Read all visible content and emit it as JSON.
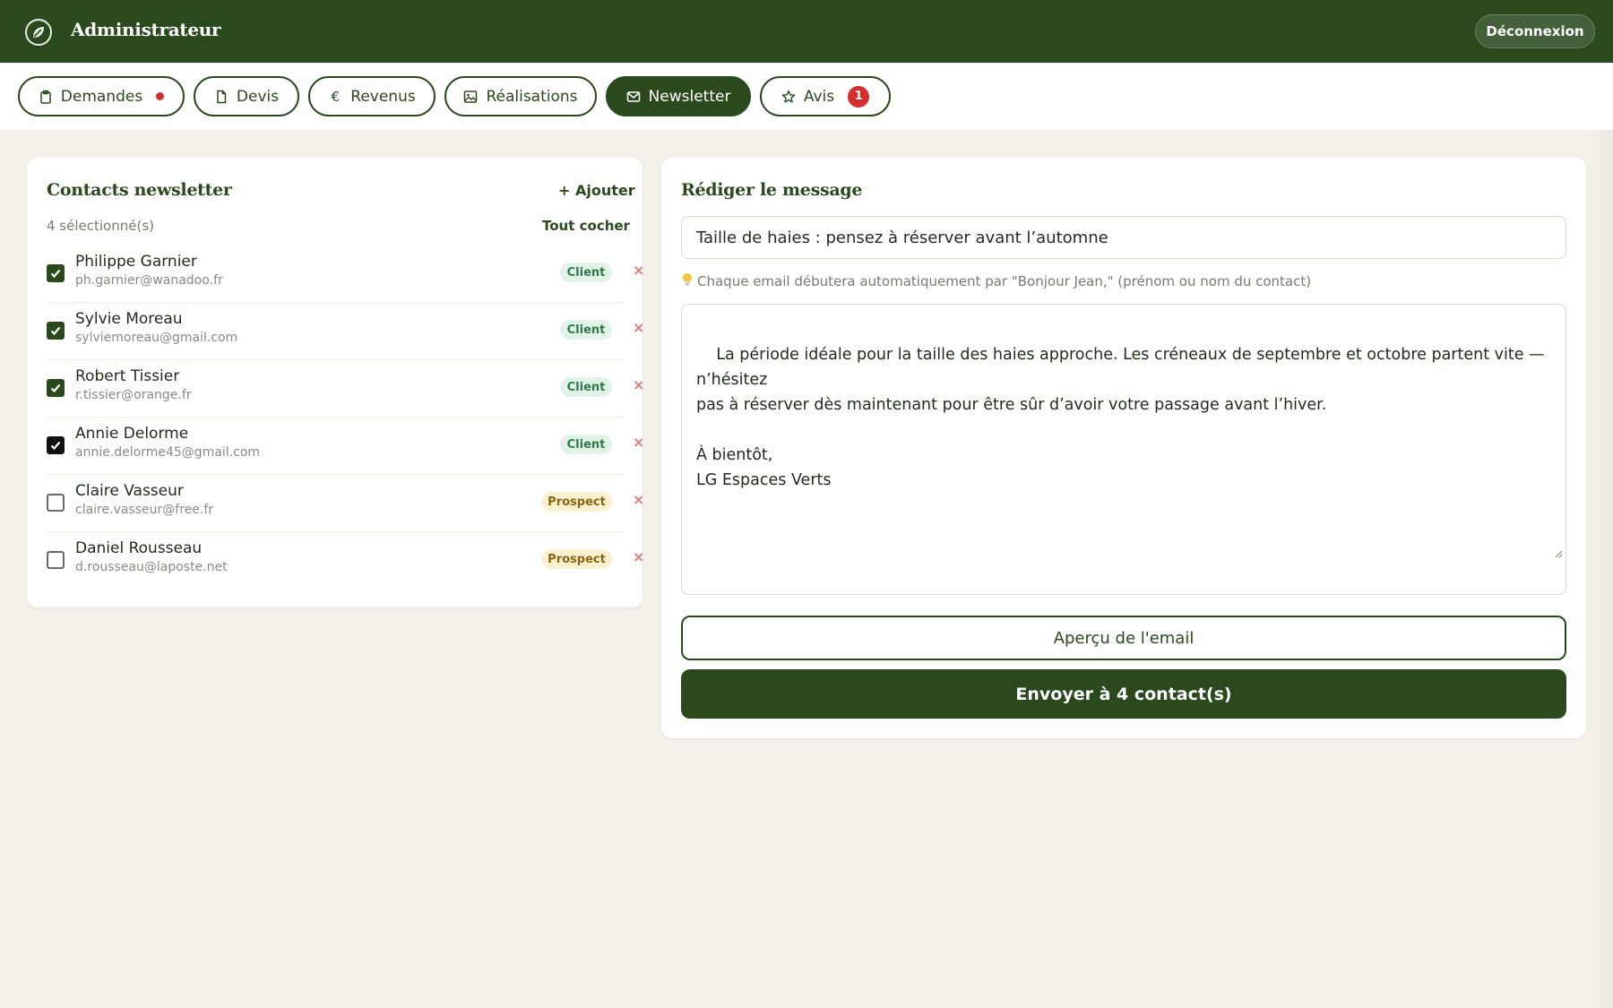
{
  "header": {
    "title": "Administrateur",
    "logout_label": "Déconnexion"
  },
  "tabs": [
    {
      "label": "Demandes",
      "icon": "clipboard-icon",
      "indicator": "dot"
    },
    {
      "label": "Devis",
      "icon": "document-icon"
    },
    {
      "label": "Revenus",
      "icon": "euro-icon"
    },
    {
      "label": "Réalisations",
      "icon": "image-icon"
    },
    {
      "label": "Newsletter",
      "icon": "mail-icon",
      "active": true
    },
    {
      "label": "Avis",
      "icon": "star-icon",
      "badge": "1"
    }
  ],
  "contacts": {
    "title": "Contacts newsletter",
    "add_label": "+ Ajouter",
    "selected_count": "4 sélectionné(s)",
    "check_all_label": "Tout cocher",
    "remove_label": "×",
    "items": [
      {
        "name": "Philippe Garnier",
        "email": "ph.garnier@wanadoo.fr",
        "tag": "Client",
        "checked": true
      },
      {
        "name": "Sylvie Moreau",
        "email": "sylviemoreau@gmail.com",
        "tag": "Client",
        "checked": true
      },
      {
        "name": "Robert Tissier",
        "email": "r.tissier@orange.fr",
        "tag": "Client",
        "checked": true
      },
      {
        "name": "Annie Delorme",
        "email": "annie.delorme45@gmail.com",
        "tag": "Client",
        "checked": true
      },
      {
        "name": "Claire Vasseur",
        "email": "claire.vasseur@free.fr",
        "tag": "Prospect",
        "checked": false
      },
      {
        "name": "Daniel Rousseau",
        "email": "d.rousseau@laposte.net",
        "tag": "Prospect",
        "checked": false
      }
    ]
  },
  "compose": {
    "title": "Rédiger le message",
    "subject": "Taille de haies : pensez à réserver avant l’automne",
    "hint": "Chaque email débutera automatiquement par \"Bonjour Jean,\" (prénom ou nom du contact)",
    "body": "La période idéale pour la taille des haies approche. Les créneaux de septembre et octobre partent vite — n’hésitez\npas à réserver dès maintenant pour être sûr d’avoir votre passage avant l’hiver.\n\nÀ bientôt,\nLG Espaces Verts",
    "preview_label": "Aperçu de l'email",
    "send_label": "Envoyer à 4 contact(s)"
  },
  "colors": {
    "brand": "#2a4a1e",
    "background": "#f4f1ea",
    "alert": "#d32f2f"
  }
}
